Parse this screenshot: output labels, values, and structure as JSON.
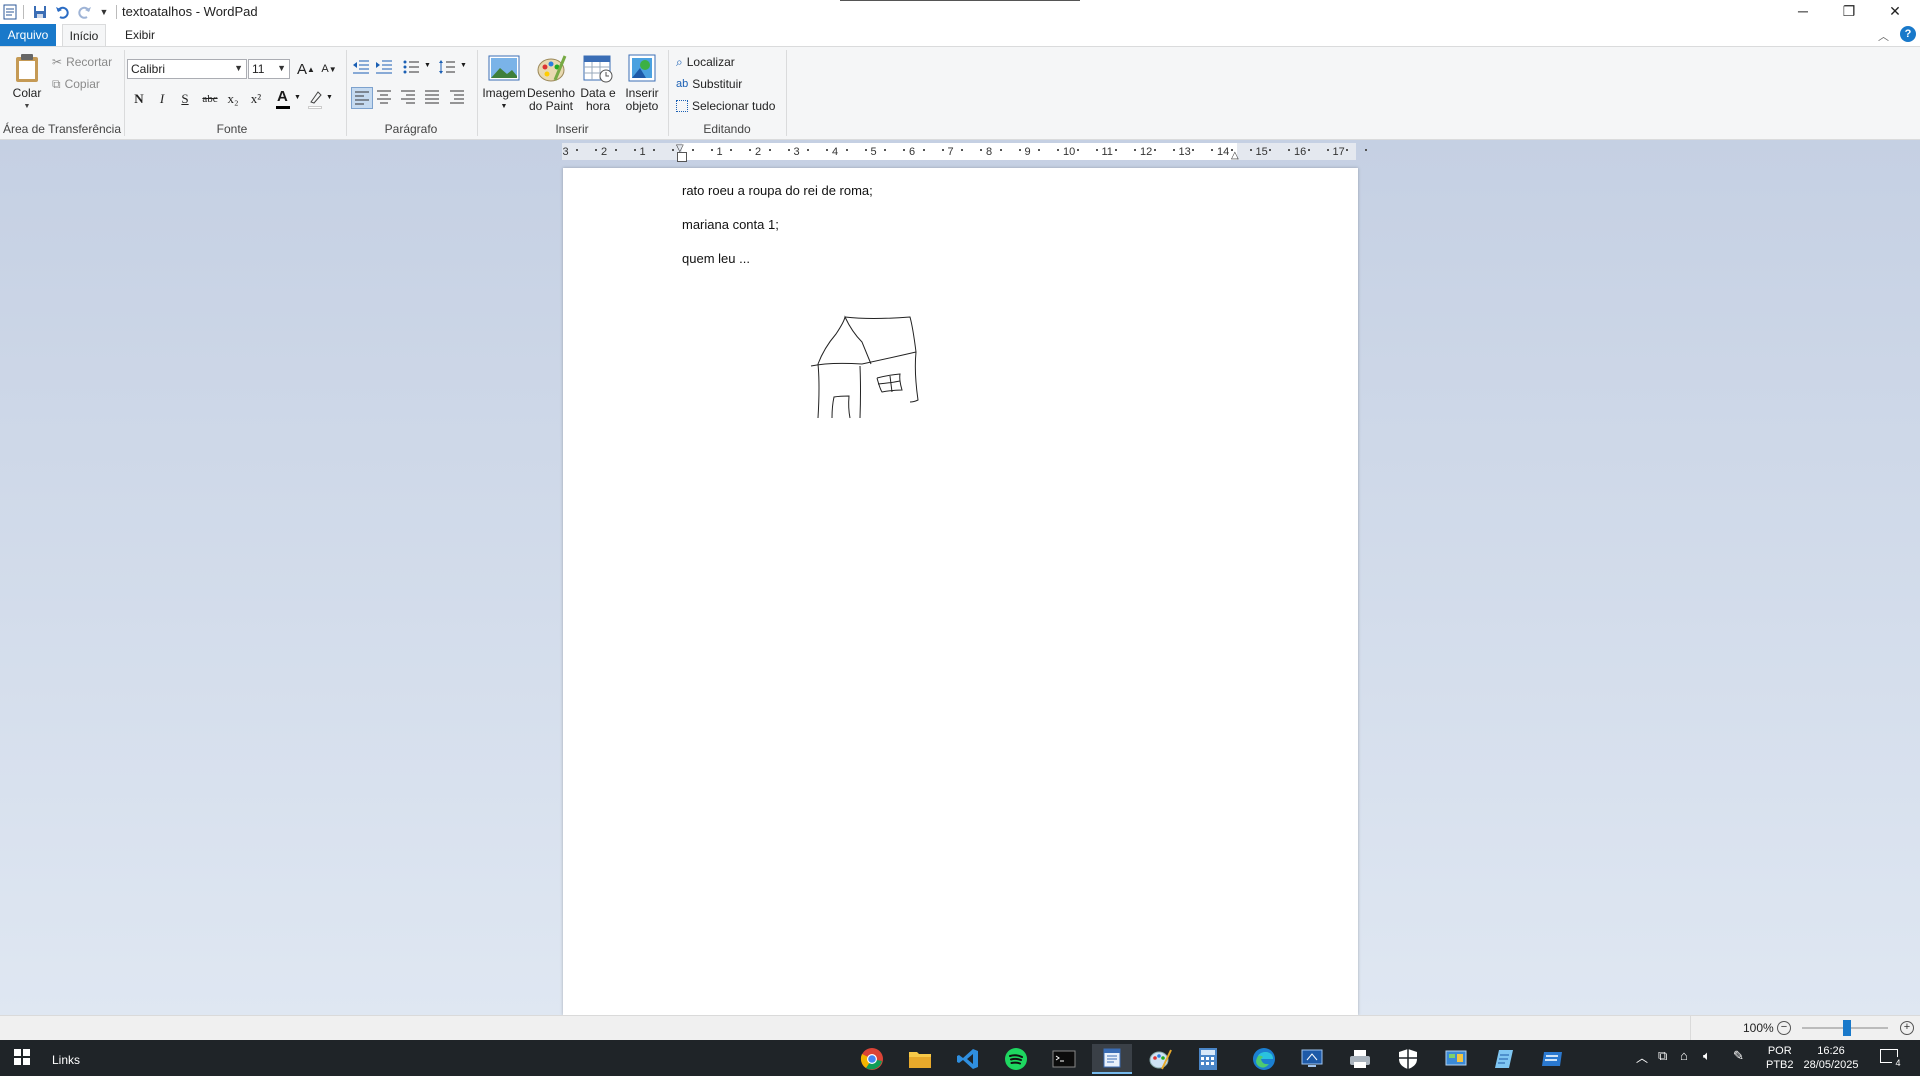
{
  "window": {
    "title": "textoatalhos - WordPad",
    "controls": {
      "minimize": "─",
      "restore": "❐",
      "close": "✕"
    }
  },
  "ribbon_tabs": [
    {
      "label": "Arquivo"
    },
    {
      "label": "Início"
    },
    {
      "label": "Exibir"
    }
  ],
  "clipboard": {
    "group_label": "Área de Transferência",
    "paste_label": "Colar",
    "cut_label": "Recortar",
    "copy_label": "Copiar"
  },
  "font": {
    "group_label": "Fonte",
    "family": "Calibri",
    "size": "11",
    "bold": "N",
    "italic": "I",
    "underline": "S",
    "strike": "abc",
    "subscript": "x₂",
    "superscript": "x²",
    "grow": "A",
    "shrink": "A",
    "color_letter": "A"
  },
  "paragraph": {
    "group_label": "Parágrafo"
  },
  "insert": {
    "group_label": "Inserir",
    "image": "Imagem",
    "paint_line1": "Desenho",
    "paint_line2": "do Paint",
    "datetime_line1": "Data e",
    "datetime_line2": "hora",
    "object_line1": "Inserir",
    "object_line2": "objeto"
  },
  "editing": {
    "group_label": "Editando",
    "find": "Localizar",
    "replace": "Substituir",
    "select_all": "Selecionar tudo"
  },
  "ruler_ticks": [
    "3",
    "2",
    "1",
    "1",
    "2",
    "3",
    "4",
    "5",
    "6",
    "7",
    "8",
    "9",
    "10",
    "11",
    "12",
    "13",
    "14",
    "15",
    "16",
    "17"
  ],
  "document": {
    "lines": [
      "rato roeu a roupa do rei de roma;",
      "mariana conta 1;",
      "quem leu ..."
    ]
  },
  "status": {
    "zoom": "100%"
  },
  "taskbar": {
    "links_label": "Links",
    "lang_line1": "POR",
    "lang_line2": "PTB2",
    "time": "16:26",
    "date": "28/05/2025",
    "notification_count": "4"
  },
  "colors": {
    "file_tab": "#1979ca",
    "ribbon_bg": "#f5f6f7",
    "workspace_top": "#c5d0e3",
    "taskbar_bg": "#1f2428",
    "font_color_bar": "#000000",
    "highlight_bar": "#ffffff"
  }
}
